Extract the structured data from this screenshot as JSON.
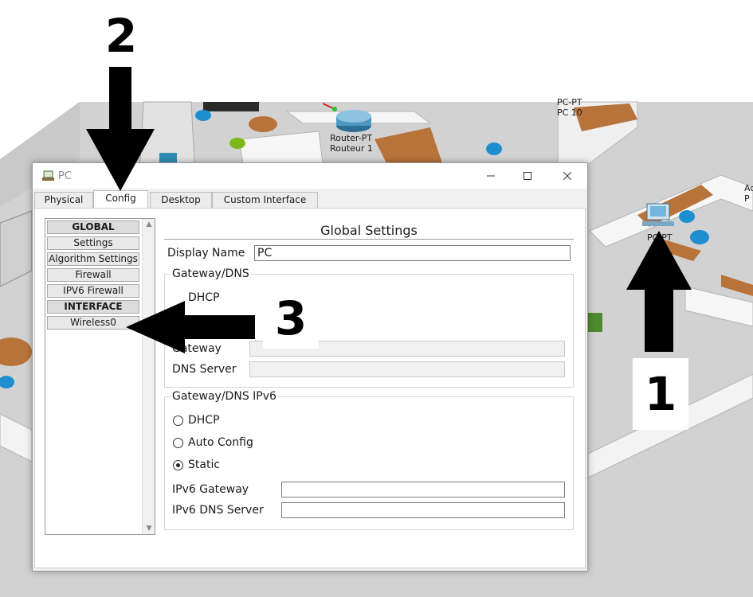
{
  "scene": {
    "devices": [
      {
        "label": "Router-PT\nRouteur 1"
      },
      {
        "label": "PC-PT\nPC 10"
      },
      {
        "label": "PC-PT"
      },
      {
        "label": "Ac\nP"
      }
    ]
  },
  "window": {
    "title": "PC",
    "tabs": [
      "Physical",
      "Config",
      "Desktop",
      "Custom Interface"
    ],
    "active_tab": "Config"
  },
  "nav": {
    "items": [
      {
        "label": "GLOBAL",
        "type": "header"
      },
      {
        "label": "Settings",
        "type": "item"
      },
      {
        "label": "Algorithm Settings",
        "type": "item"
      },
      {
        "label": "Firewall",
        "type": "item"
      },
      {
        "label": "IPV6 Firewall",
        "type": "item"
      },
      {
        "label": "INTERFACE",
        "type": "header"
      },
      {
        "label": "Wireless0",
        "type": "item"
      }
    ]
  },
  "global_settings": {
    "title": "Global Settings",
    "display_name_label": "Display Name",
    "display_name_value": "PC",
    "ipv4_group": {
      "legend": "Gateway/DNS",
      "dhcp_label": "DHCP",
      "gateway_label": "Gateway",
      "dns_label": "DNS Server"
    },
    "ipv6_group": {
      "legend": "Gateway/DNS IPv6",
      "options": [
        "DHCP",
        "Auto Config",
        "Static"
      ],
      "selected": "Static",
      "gateway_label": "IPv6 Gateway",
      "dns_label": "IPv6 DNS Server"
    }
  },
  "annotations": {
    "step1": "1",
    "step2": "2",
    "step3": "3"
  },
  "colors": {
    "accent_blue": "#1e90c8",
    "wall": "#f2f2f2",
    "floor": "#d4d4d4"
  }
}
